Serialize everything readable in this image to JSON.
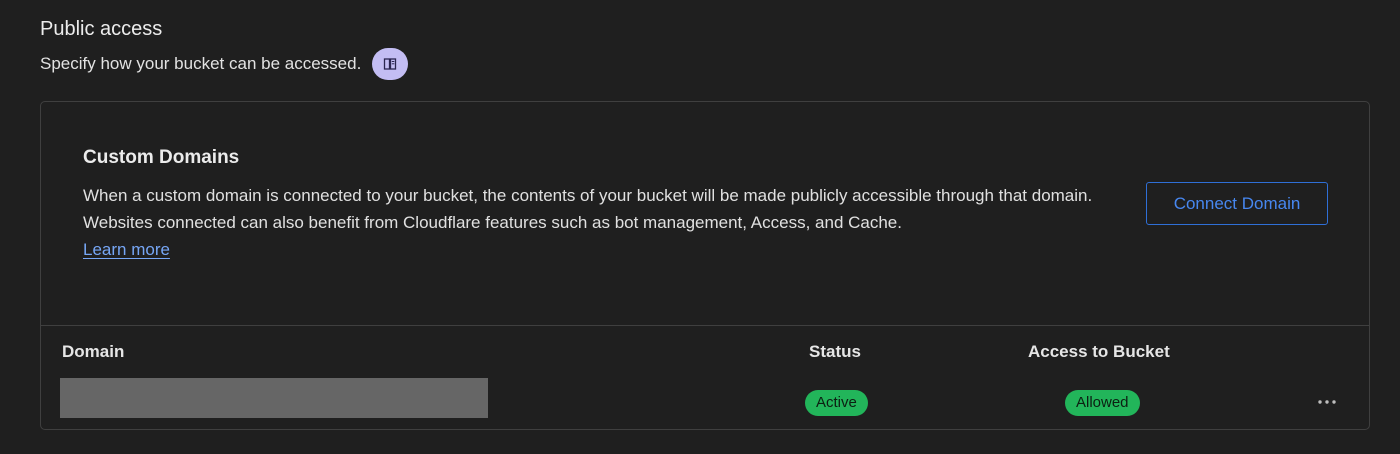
{
  "header": {
    "title": "Public access",
    "subtitle": "Specify how your bucket can be accessed.",
    "docs_icon": "book-icon"
  },
  "custom_domains": {
    "title": "Custom Domains",
    "description": "When a custom domain is connected to your bucket, the contents of your bucket will be made publicly accessible through that domain. Websites connected can also benefit from Cloudflare features such as bot management, Access, and Cache.",
    "learn_more": "Learn more",
    "connect_button": "Connect Domain",
    "table": {
      "columns": [
        "Domain",
        "Status",
        "Access to Bucket"
      ],
      "rows": [
        {
          "domain": "",
          "status": "Active",
          "access": "Allowed",
          "actions_icon": "more-horizontal-icon"
        }
      ]
    }
  },
  "colors": {
    "background": "#1f1f1f",
    "border": "#3f3f3f",
    "link": "#76a6f5",
    "primary_button": "#4787f0",
    "badge_green": "#22b55a",
    "docs_icon_bg": "#c3bdf3"
  }
}
